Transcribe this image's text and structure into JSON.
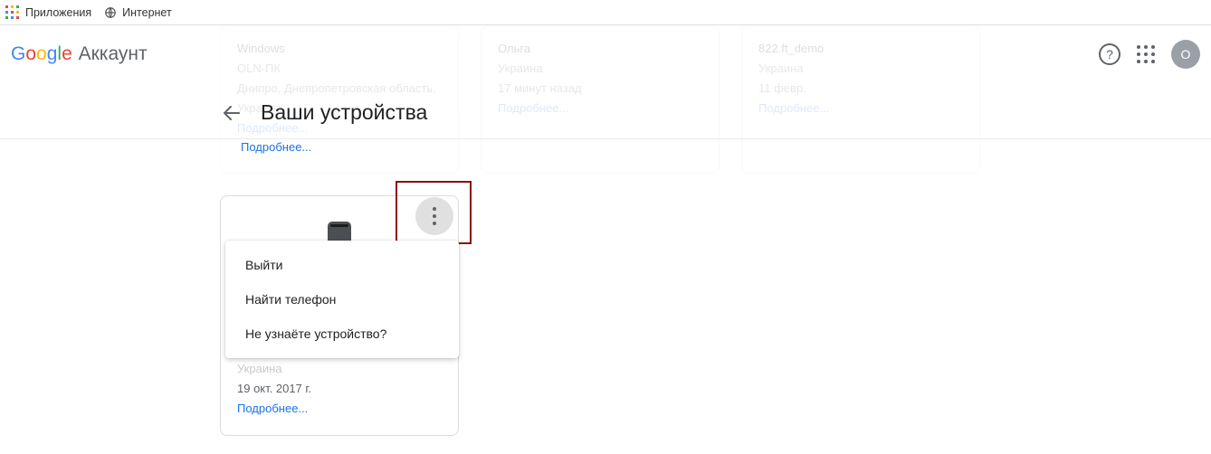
{
  "bookmarks": {
    "apps": "Приложения",
    "internet": "Интернет"
  },
  "header": {
    "product": "Аккаунт",
    "avatar_letter": "O"
  },
  "subheader": {
    "title": "Ваши устройства"
  },
  "bg_cards": [
    {
      "line1": "Windows",
      "line2": "OLN-ПК",
      "line3": "Днипро, Днепропетровская область, Украина",
      "more": "Подробнее..."
    },
    {
      "line1": "Ольга",
      "line2": "Украина",
      "line3": "17 минут назад",
      "more": "Подробнее..."
    },
    {
      "line1": "822.ft_demo",
      "line2": "Украина",
      "line3": "11 февр.",
      "more": "Подробнее..."
    }
  ],
  "top_more_link": "Подробнее...",
  "fg_card": {
    "country": "Украина",
    "date": "19 окт. 2017 г.",
    "more": "Подробнее..."
  },
  "menu": {
    "signout": "Выйти",
    "find_phone": "Найти телефон",
    "dont_recognize": "Не узнаёте устройство?"
  }
}
